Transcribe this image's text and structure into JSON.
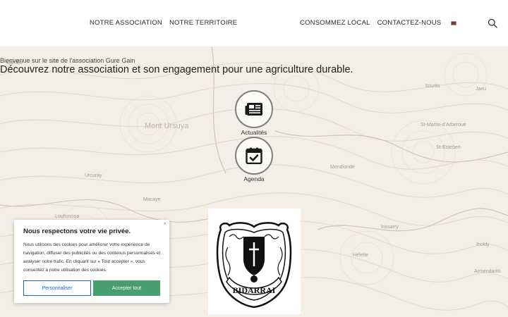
{
  "header": {
    "nav_left": [
      "NOTRE ASSOCIATION",
      "NOTRE TERRITOIRE"
    ],
    "nav_right": [
      "CONSOMMEZ LOCAL",
      "CONTACTEZ-NOUS"
    ],
    "flag_icon": "basque-flag-icon",
    "search_icon": "search-icon"
  },
  "intro": {
    "welcome": "Bienvenue sur le site de l'association Gure Gain",
    "headline": "Découvrez notre association et son engagement pour une agriculture durable."
  },
  "quick_links": [
    {
      "label": "Actualités",
      "icon": "newspaper-icon"
    },
    {
      "label": "Agenda",
      "icon": "calendar-check-icon"
    }
  ],
  "logo": {
    "text": "BIDARRAI"
  },
  "map_labels": [
    "Mont Ursuya",
    "St-Martin-d'Arberoue",
    "Macaye",
    "Louhossoa",
    "Hélette",
    "Iholdy",
    "Irissarry",
    "Mendionde",
    "Armendarits",
    "Jaxu",
    "St-Esteben",
    "Isturits",
    "Cambo",
    "Urcuray"
  ],
  "cookie": {
    "title": "Nous respectons votre vie privée.",
    "close": "×",
    "text": "Nous utilisons des cookies pour améliorer votre expérience de navigation, diffuser des publicités ou des contenus personnalisés et analyser notre trafic. En cliquant sur « Tout accepter », vous consentez à notre utilisation des cookies.",
    "customize_label": "Personnaliser",
    "accept_label": "Accepter tout"
  }
}
